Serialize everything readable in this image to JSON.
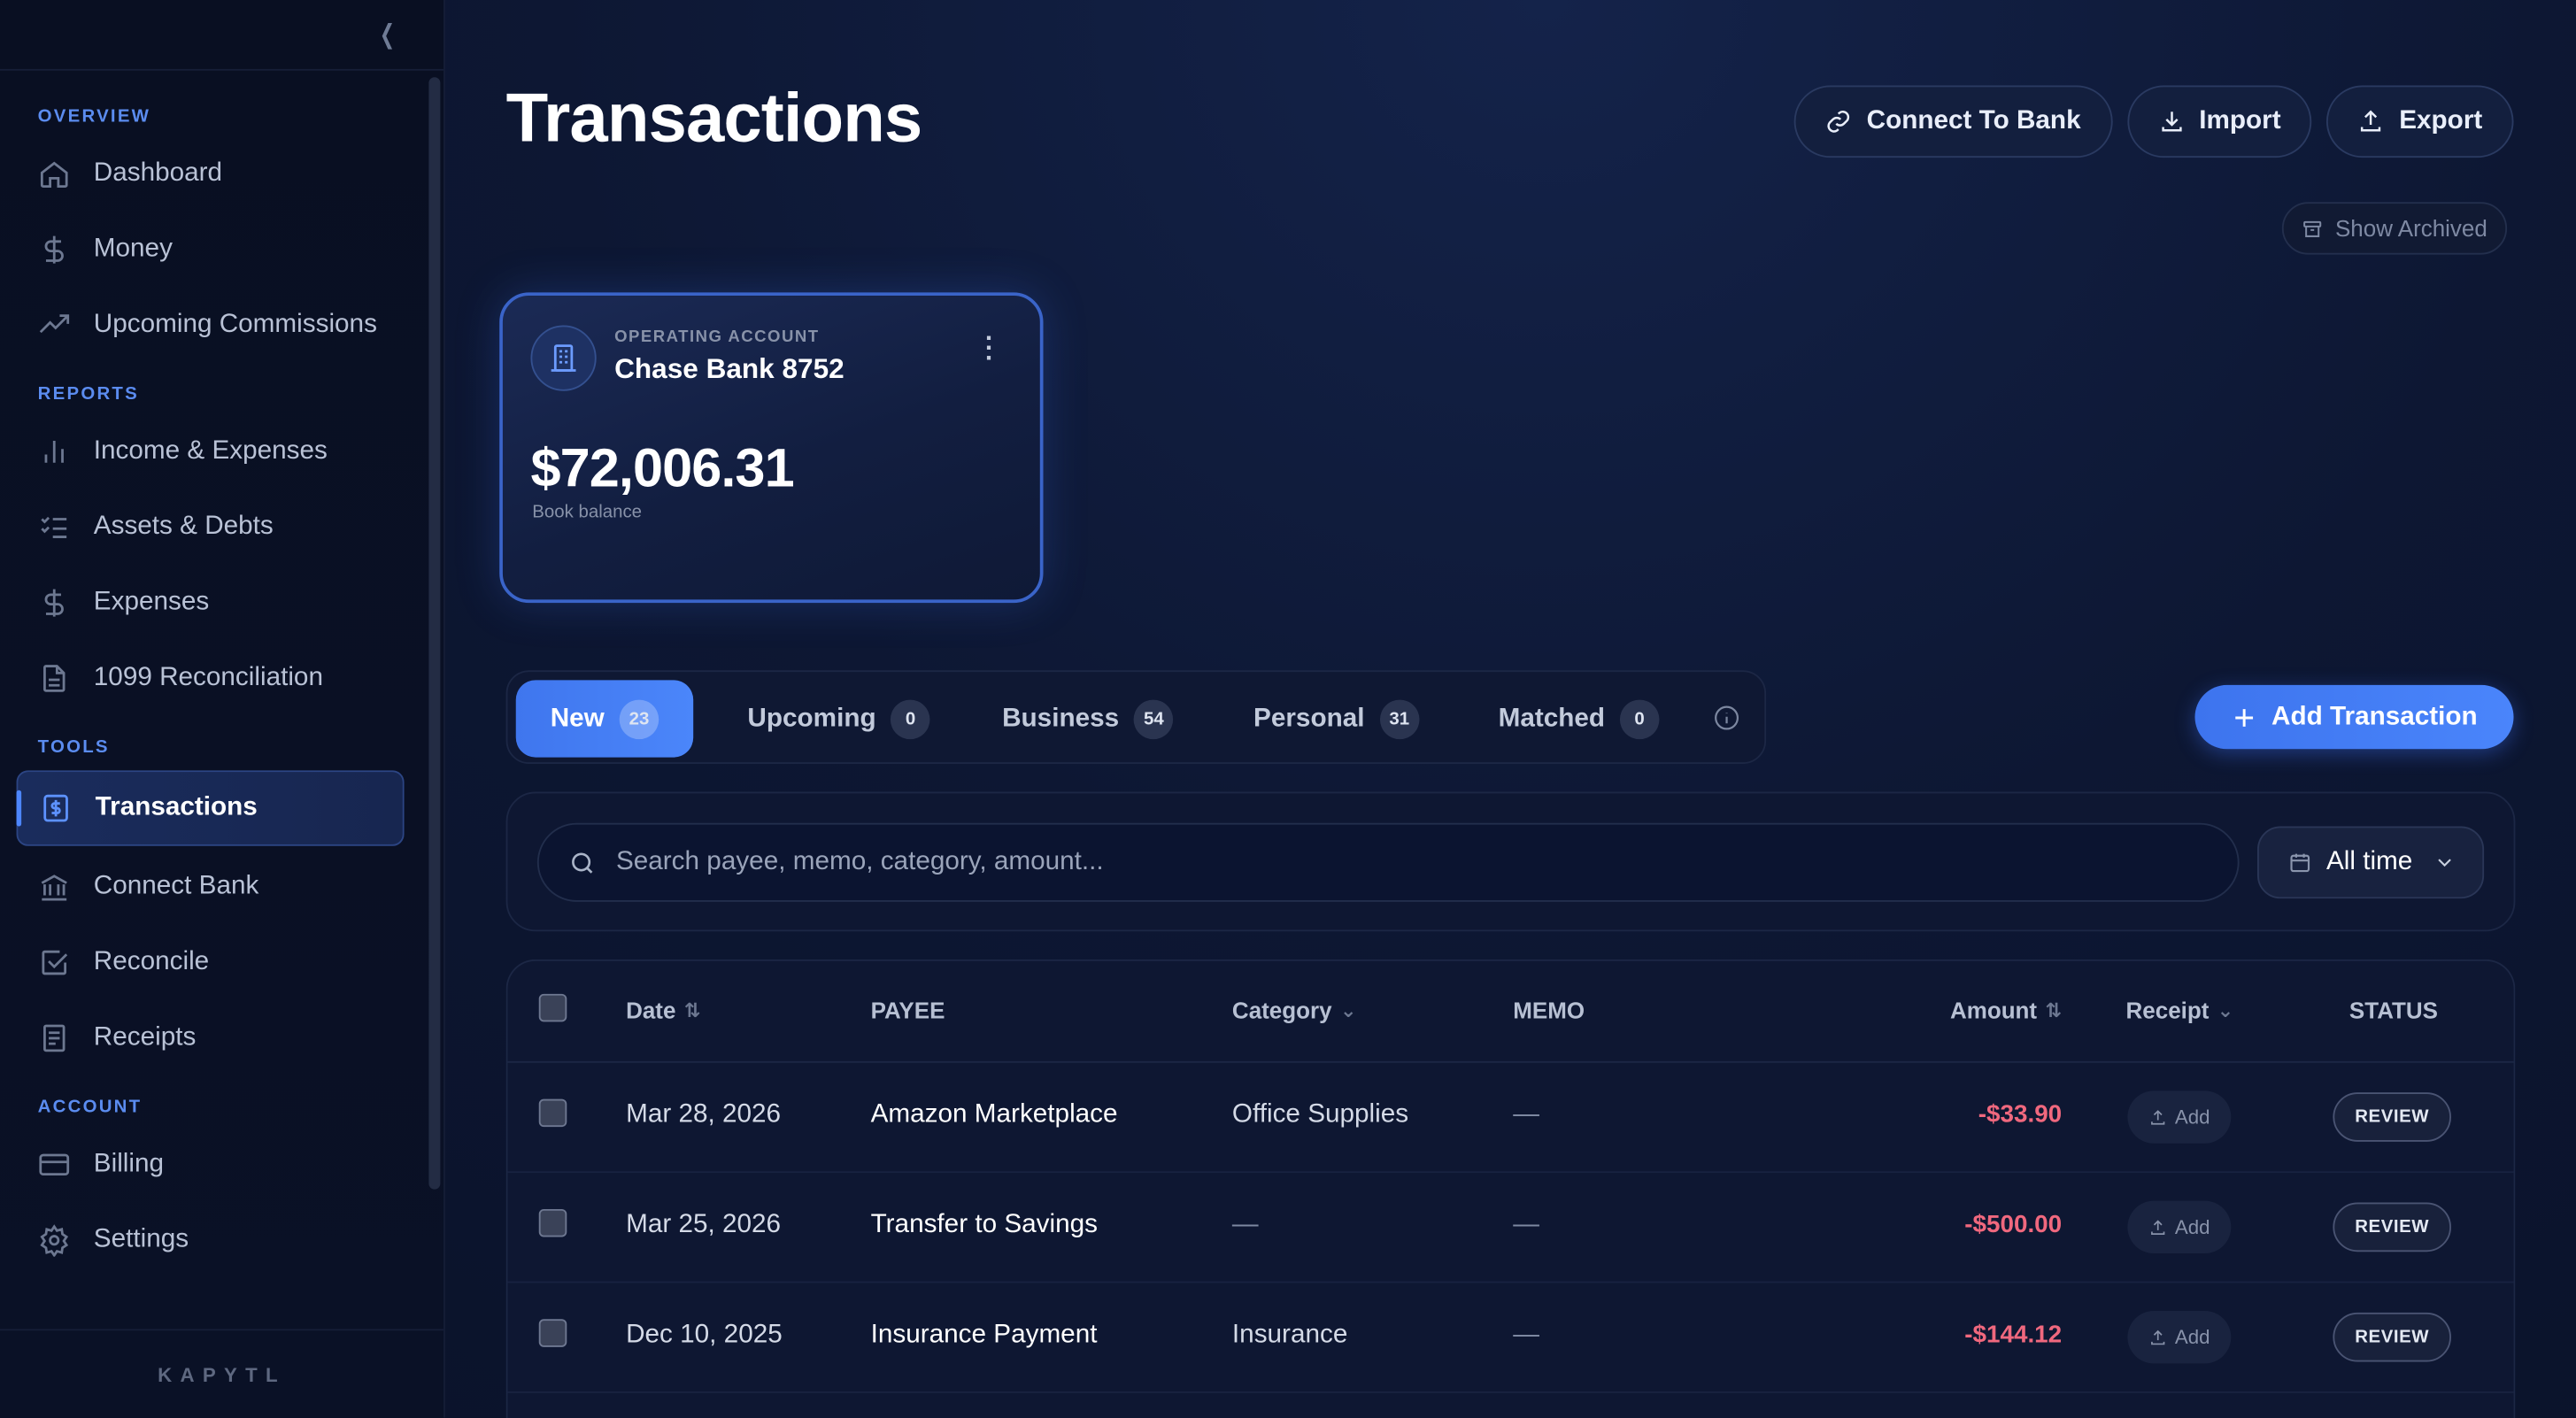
{
  "sidebar": {
    "sections": [
      {
        "title": "OVERVIEW",
        "items": [
          {
            "label": "Dashboard",
            "icon": "home-icon"
          },
          {
            "label": "Money",
            "icon": "dollar-icon"
          },
          {
            "label": "Upcoming Commissions",
            "icon": "trending-up-icon"
          }
        ]
      },
      {
        "title": "REPORTS",
        "items": [
          {
            "label": "Income & Expenses",
            "icon": "bar-chart-icon"
          },
          {
            "label": "Assets & Debts",
            "icon": "checklist-icon"
          },
          {
            "label": "Expenses",
            "icon": "dollar-icon"
          },
          {
            "label": "1099 Reconciliation",
            "icon": "document-icon"
          }
        ]
      },
      {
        "title": "TOOLS",
        "items": [
          {
            "label": "Transactions",
            "icon": "receipt-dollar-icon",
            "active": true
          },
          {
            "label": "Connect Bank",
            "icon": "bank-icon"
          },
          {
            "label": "Reconcile",
            "icon": "check-square-icon"
          },
          {
            "label": "Receipts",
            "icon": "receipt-icon"
          }
        ]
      },
      {
        "title": "ACCOUNT",
        "items": [
          {
            "label": "Billing",
            "icon": "credit-card-icon"
          },
          {
            "label": "Settings",
            "icon": "gear-icon"
          }
        ]
      }
    ],
    "brand": "KAPYTL"
  },
  "header": {
    "title": "Transactions",
    "buttons": {
      "connect": "Connect To Bank",
      "import": "Import",
      "export": "Export"
    },
    "show_archived": "Show Archived"
  },
  "account_card": {
    "label": "OPERATING ACCOUNT",
    "name": "Chase Bank 8752",
    "balance": "$72,006.31",
    "balance_label": "Book balance"
  },
  "tabs": [
    {
      "label": "New",
      "count": "23",
      "active": true
    },
    {
      "label": "Upcoming",
      "count": "0"
    },
    {
      "label": "Business",
      "count": "54"
    },
    {
      "label": "Personal",
      "count": "31"
    },
    {
      "label": "Matched",
      "count": "0"
    }
  ],
  "add_transaction": "Add Transaction",
  "search": {
    "placeholder": "Search payee, memo, category, amount...",
    "value": ""
  },
  "time_filter": {
    "selected": "All time"
  },
  "table": {
    "columns": {
      "date": "Date",
      "payee": "PAYEE",
      "category": "Category",
      "memo": "MEMO",
      "amount": "Amount",
      "receipt": "Receipt",
      "status": "STATUS"
    },
    "rows": [
      {
        "date": "Mar 28, 2026",
        "payee": "Amazon Marketplace",
        "category": "Office Supplies",
        "memo": "—",
        "amount": "-$33.90",
        "receipt": "Add",
        "status": "REVIEW"
      },
      {
        "date": "Mar 25, 2026",
        "payee": "Transfer to Savings",
        "category": "—",
        "memo": "—",
        "amount": "-$500.00",
        "receipt": "Add",
        "status": "REVIEW"
      },
      {
        "date": "Dec 10, 2025",
        "payee": "Insurance Payment",
        "category": "Insurance",
        "memo": "—",
        "amount": "-$144.12",
        "receipt": "Add",
        "status": "REVIEW"
      }
    ]
  },
  "colors": {
    "accent": "#4a85fb",
    "negative": "#f0687e",
    "background": "#0a1229"
  }
}
